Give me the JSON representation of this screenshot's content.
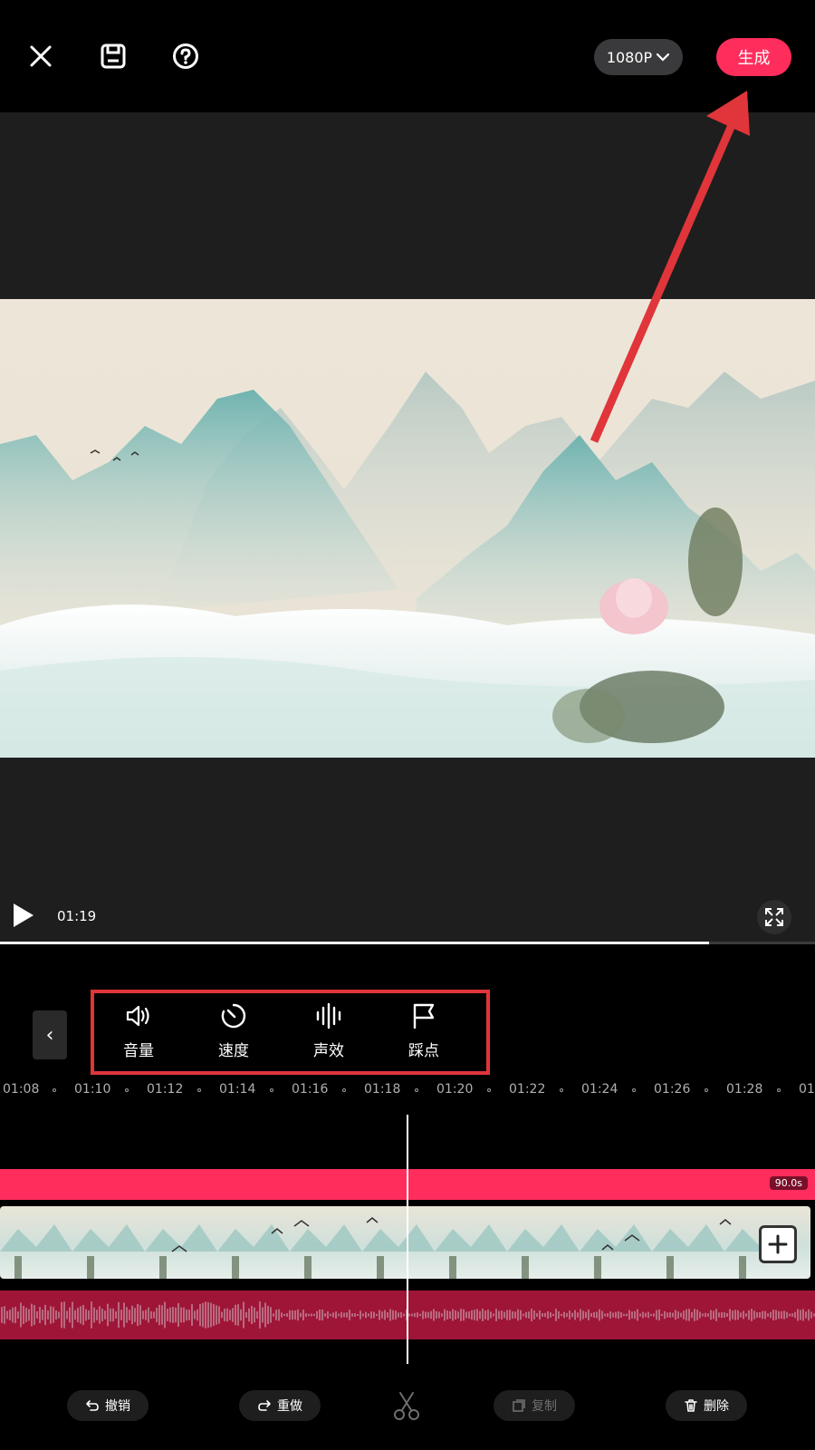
{
  "header": {
    "close_icon": "close-icon",
    "save_icon": "save-icon",
    "help_icon": "help-icon",
    "resolution": "1080P",
    "generate_label": "生成"
  },
  "player": {
    "current_time": "01:19",
    "progress": 0.87
  },
  "tools": [
    {
      "label": "音量",
      "icon": "volume-icon"
    },
    {
      "label": "速度",
      "icon": "speed-icon"
    },
    {
      "label": "声效",
      "icon": "sound-effect-icon"
    },
    {
      "label": "踩点",
      "icon": "beat-flag-icon"
    }
  ],
  "ruler": {
    "ticks": [
      "01:08",
      "01:10",
      "01:12",
      "01:14",
      "01:16",
      "01:18",
      "01:20",
      "01:22",
      "01:24",
      "01:26",
      "01:28",
      "01"
    ]
  },
  "timeline": {
    "duration_badge": "90.0s"
  },
  "actions": {
    "undo": "撤销",
    "redo": "重做",
    "copy": "复制",
    "delete": "删除"
  },
  "colors": {
    "accent": "#ff2d5c",
    "annotation": "#e0353a",
    "audio_track": "#9e1538"
  }
}
